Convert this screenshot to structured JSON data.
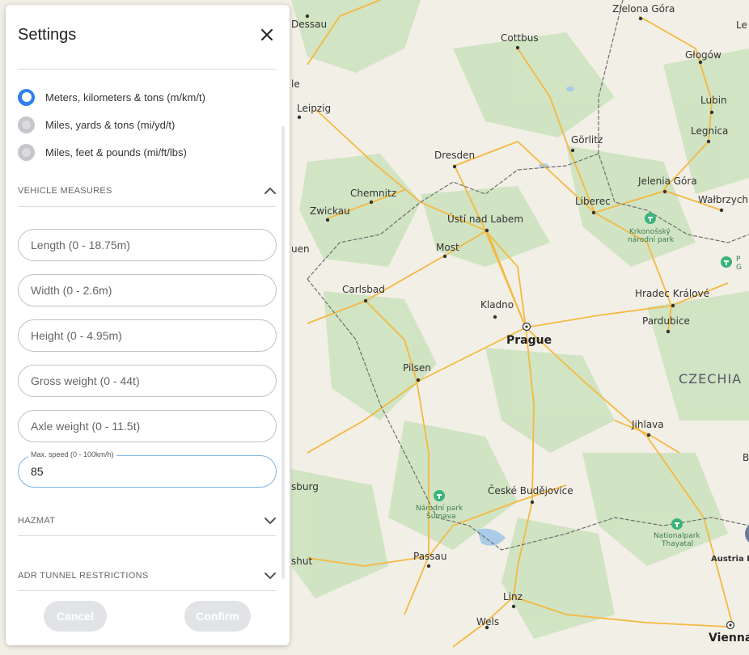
{
  "panel": {
    "title": "Settings",
    "units": [
      {
        "label": "Meters, kilometers & tons (m/km/t)",
        "checked": true
      },
      {
        "label": "Miles, yards & tons (mi/yd/t)",
        "checked": false
      },
      {
        "label": "Miles, feet & pounds (mi/ft/lbs)",
        "checked": false
      }
    ],
    "vehicle_measures": {
      "heading": "VEHICLE MEASURES",
      "length_placeholder": "Length (0 - 18.75m)",
      "width_placeholder": "Width (0 - 2.6m)",
      "height_placeholder": "Height (0 - 4.95m)",
      "gross_weight_placeholder": "Gross weight (0 - 44t)",
      "axle_weight_placeholder": "Axle weight (0 - 11.5t)",
      "max_speed_label": "Max. speed (0 - 100km/h)",
      "max_speed_value": "85"
    },
    "hazmat_heading": "HAZMAT",
    "adr_heading": "ADR TUNNEL RESTRICTIONS",
    "cancel_label": "Cancel",
    "confirm_label": "Confirm"
  },
  "map": {
    "countries": [
      "CZECHIA"
    ],
    "cities": {
      "prague": "Prague",
      "dresden": "Dresden",
      "leipzig": "Leipzig",
      "chemnitz": "Chemnitz",
      "zwickau": "Zwickau",
      "usti": "Ústí nad Labem",
      "most": "Most",
      "liberec": "Liberec",
      "gorlitz": "Görlitz",
      "cottbus": "Cottbus",
      "zielona": "Zielona Góra",
      "glogow": "Głogów",
      "lubin": "Lubin",
      "legnica": "Legnica",
      "jelenia": "Jelenia Góra",
      "walbrzych": "Wałbrzych",
      "carlsbad": "Carlsbad",
      "kladno": "Kladno",
      "hradec": "Hradec Králové",
      "pardubice": "Pardubice",
      "pilsen": "Pilsen",
      "jihlava": "Jihlava",
      "budejovice": "České Budějovice",
      "passau": "Passau",
      "linz": "Linz",
      "wels": "Wels",
      "vienna": "Vienna",
      "dessau": "Dessau",
      "austria_po": "Austria Po",
      "edge_le": "Le",
      "edge_le2": "le",
      "edge_uen": "uen",
      "edge_sburg": "sburg",
      "edge_shut": "shut",
      "edge_b": "B"
    },
    "parks": {
      "krkonose_1": "Krkonošský",
      "krkonose_2": "národní park",
      "sumava_1": "Národní park",
      "sumava_2": "Šumava",
      "thayatal_1": "Nationalpark",
      "thayatal_2": "Thayatal",
      "edge_p": "P",
      "edge_g": "G"
    },
    "colors": {
      "land": "#f2efe6",
      "forest": "#cfe3c1",
      "road": "#f4b942",
      "border": "#6f6f6f",
      "water": "#a9cbe8",
      "accent": "#2f80ed"
    }
  }
}
